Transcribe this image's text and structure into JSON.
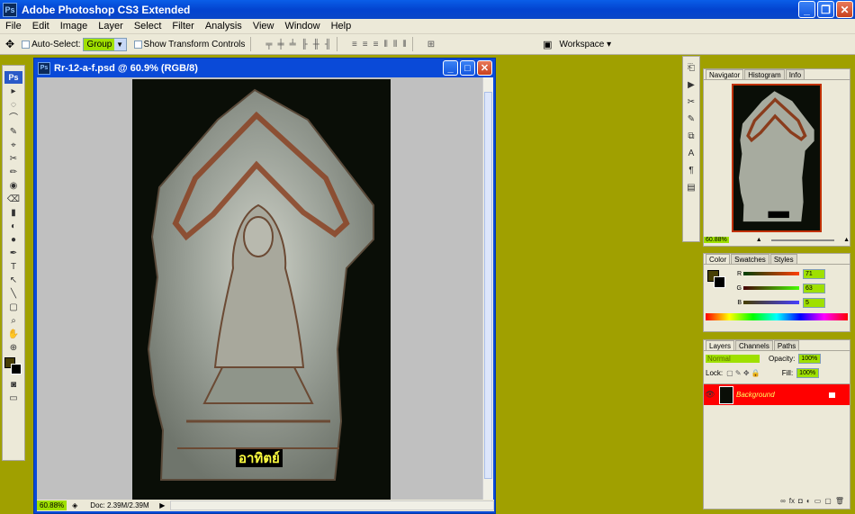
{
  "app": {
    "title": "Adobe Photoshop CS3 Extended",
    "icon": "Ps",
    "window_buttons": [
      "_",
      "❐",
      "✕"
    ]
  },
  "menu": [
    "File",
    "Edit",
    "Image",
    "Layer",
    "Select",
    "Filter",
    "Analysis",
    "View",
    "Window",
    "Help"
  ],
  "options": {
    "tool_icon": "move-icon",
    "auto_select_label": "Auto-Select:",
    "auto_select_value": "Group",
    "show_transform_label": "Show Transform Controls",
    "workspace_label": "Workspace ▾"
  },
  "toolbox": {
    "logo": "Ps",
    "tools": [
      "▸",
      "◌",
      "⌒",
      "✎",
      "⌖",
      "✂",
      "✏",
      "◉",
      "⌫",
      "▮",
      "◐",
      "●",
      "✒",
      "T",
      "↖",
      "╲",
      "▢",
      "⌕",
      "✋",
      "⊕"
    ]
  },
  "document": {
    "title": "Rr-12-a-f.psd @ 60.9% (RGB/8)",
    "caption": "อาทิตย์",
    "zoom": "60.88%",
    "doc_size": "Doc: 2.39M/2.39M",
    "accent_color": "#9fe000"
  },
  "navigator": {
    "tabs": [
      "Navigator",
      "Histogram",
      "Info"
    ],
    "zoom": "60.88%"
  },
  "color_panel": {
    "tabs": [
      "Color",
      "Swatches",
      "Styles"
    ],
    "r_label": "R",
    "r_value": "71",
    "g_label": "G",
    "g_value": "63",
    "b_label": "B",
    "b_value": "5",
    "foreground": "#473f05"
  },
  "layers": {
    "tabs": [
      "Layers",
      "Channels",
      "Paths"
    ],
    "blend_mode": "Normal",
    "opacity_label": "Opacity:",
    "opacity_value": "100%",
    "lock_label": "Lock:",
    "fill_label": "Fill:",
    "fill_value": "100%",
    "layer_name": "Background",
    "selected_color": "#ff0000"
  }
}
